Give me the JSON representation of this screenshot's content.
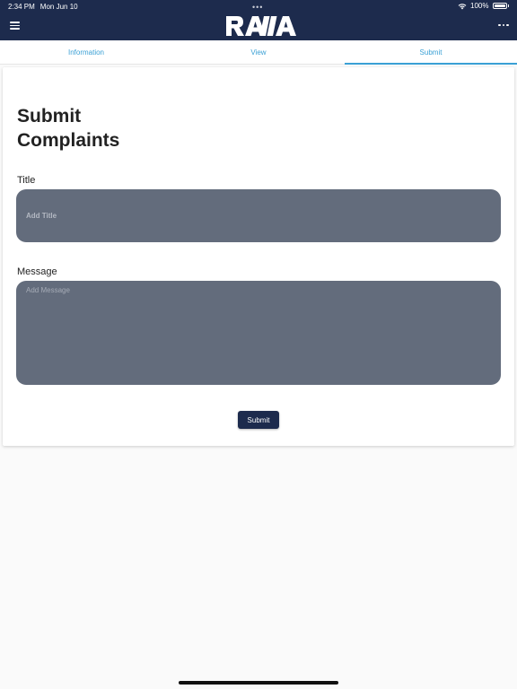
{
  "status_bar": {
    "time": "2:34 PM",
    "date": "Mon Jun 10",
    "dots": "•••",
    "battery": "100%"
  },
  "header": {
    "logo_text": "RAYA",
    "menu_icon": "hamburger-menu-icon",
    "more_icon": "more-horizontal-icon",
    "background_color": "#1d2b4d"
  },
  "tabs": [
    {
      "label": "Information",
      "active": false
    },
    {
      "label": "View",
      "active": false
    },
    {
      "label": "Submit",
      "active": true
    }
  ],
  "form": {
    "heading": "Submit Complaints",
    "title_label": "Title",
    "title_placeholder": "Add Title",
    "title_value": "",
    "message_label": "Message",
    "message_placeholder": "Add Message",
    "message_value": "",
    "submit_label": "Submit"
  },
  "colors": {
    "accent": "#3aa0d5",
    "input_background": "#636c7c",
    "button_background": "#1d2b4d"
  }
}
